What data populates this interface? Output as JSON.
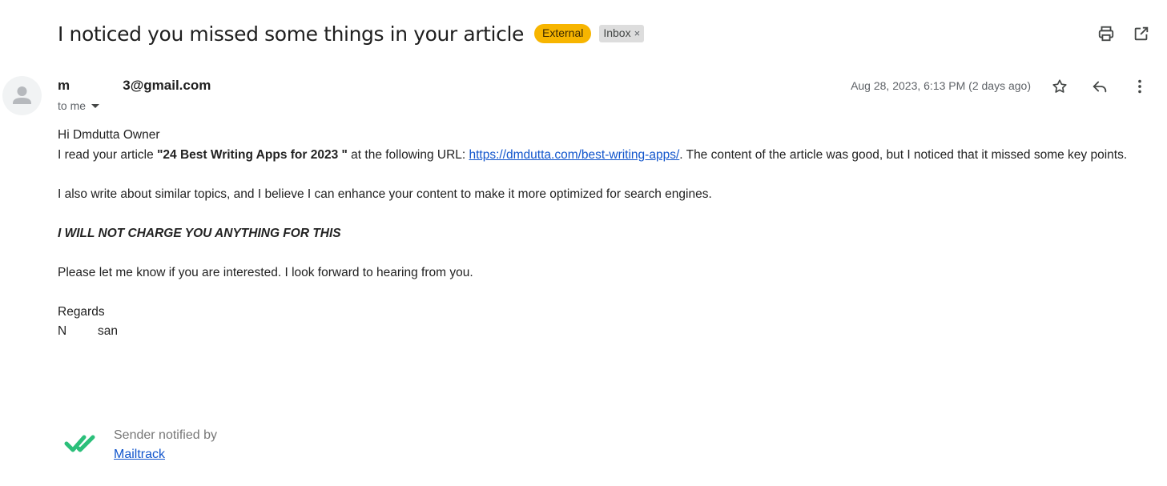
{
  "email": {
    "subject": "I noticed you missed some things in your article",
    "labels": {
      "external": "External",
      "inbox": "Inbox",
      "inbox_remove": "×"
    },
    "sender": "m              3@gmail.com",
    "recipient": "to me",
    "date": "Aug 28, 2023, 6:13 PM (2 days ago)",
    "body": {
      "greeting": "Hi Dmdutta Owner",
      "line1_prefix": "I read your article ",
      "article_title": "\"24 Best Writing Apps for 2023 \"",
      "line1_mid": " at the following URL: ",
      "url": "https://dmdutta.com/best-writing-apps/",
      "line1_suffix": ". The content of the article was good, but I noticed that it missed some key points.",
      "para2": "I also write about similar topics, and I believe I can enhance your content to make it more optimized for search engines.",
      "para3": "I WILL NOT CHARGE YOU ANYTHING FOR THIS",
      "para4": "Please let me know if you are interested. I look forward to hearing from you.",
      "closing": "Regards",
      "signature": "N         san"
    }
  },
  "mailtrack": {
    "notice": "Sender notified by",
    "link": "Mailtrack",
    "color": "#2bbf7a"
  },
  "icons": {
    "print": "print-icon",
    "popout": "open-in-new-window-icon",
    "star": "star-icon",
    "reply": "reply-icon",
    "more": "more-vert-icon",
    "avatar": "person-icon"
  },
  "colors": {
    "external_badge": "#f7b500",
    "inbox_badge": "#dddddd",
    "link": "#1155cc"
  }
}
